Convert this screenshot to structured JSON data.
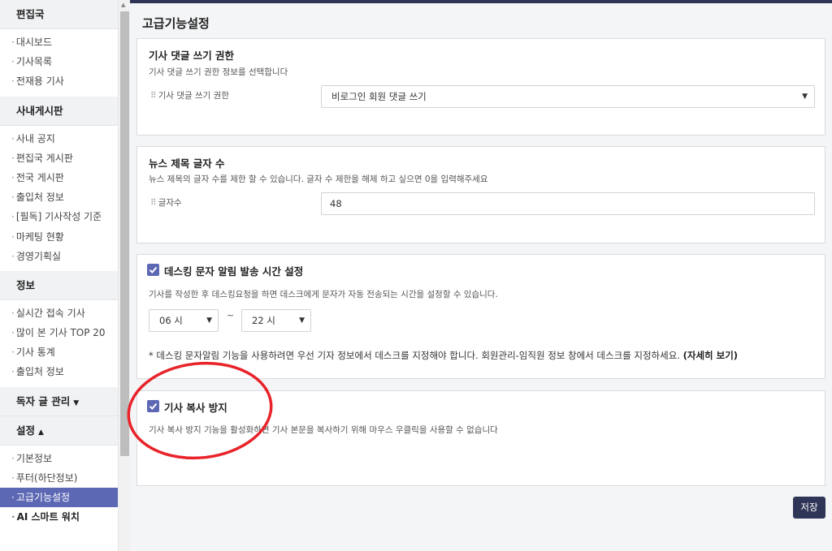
{
  "sidebar": {
    "sections": [
      {
        "title": "편집국",
        "items": [
          "대시보드",
          "기사목록",
          "전재용 기사"
        ]
      },
      {
        "title": "사내게시판",
        "items": [
          "사내 공지",
          "편집국 게시판",
          "전국 게시판",
          "출입처 정보",
          "[필독] 기사작성 기준",
          "마케팅 현황",
          "경영기획실"
        ]
      },
      {
        "title": "정보",
        "items": [
          "실시간 접속 기사",
          "많이 본 기사 TOP 20",
          "기사 통계",
          "출입처 정보"
        ]
      },
      {
        "title": "독자 글 관리",
        "caret": "▼",
        "items": []
      },
      {
        "title": "설정",
        "caret": "▲",
        "items": [
          "기본정보",
          "푸터(하단정보)",
          "고급기능설정",
          "AI 스마트 워치"
        ]
      }
    ],
    "dot": "·"
  },
  "page": {
    "title": "고급기능설정"
  },
  "comment_panel": {
    "title": "기사 댓글 쓰기 권한",
    "desc": "기사 댓글 쓰기 권한 정보를 선택합니다",
    "label": "기사 댓글 쓰기 권한",
    "selected": "비로그인 회원 댓글 쓰기"
  },
  "title_length_panel": {
    "title": "뉴스 제목 글자 수",
    "desc": "뉴스 제목의 글자 수를 제한 할 수 있습니다. 글자 수 제한을 해제 하고 싶으면 0을 입력해주세요",
    "label": "글자수",
    "value": "48"
  },
  "desking_panel": {
    "title": "데스킹 문자 알림 발송 시간 설정",
    "checked": true,
    "desc": "기사를 작성한 후 데스킹요청을 하면 데스크에게 문자가 자동 전송되는 시간을 설정할 수 있습니다.",
    "from": "06 시",
    "to": "22 시",
    "separator": "~",
    "note": "* 데스킹 문자알림 기능을 사용하려면 우선 기자 정보에서 데스크를 지정해야 합니다. 회원관리-임직원 정보 창에서 데스크를 지정하세요.",
    "note_link": "(자세히 보기)"
  },
  "copy_protect_panel": {
    "title": "기사 복사 방지",
    "checked": true,
    "desc": "기사 복사 방지 기능을 활성화하면 기사 본문을 복사하기 위해 마우스 우클릭을 사용할 수 없습니다"
  },
  "save_label": "저장",
  "grip": "⠿",
  "colors": {
    "accent": "#5d68b5",
    "navy": "#2f3556",
    "annotation": "#e8232a"
  },
  "icons": {
    "select_arrow": "▼",
    "scroll_up": "▲"
  }
}
